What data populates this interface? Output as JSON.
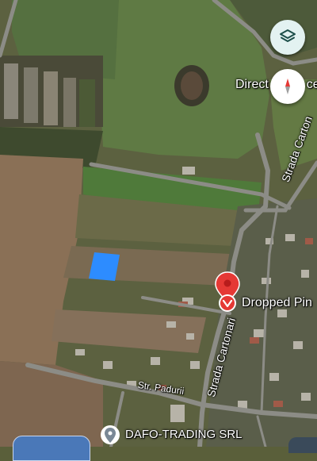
{
  "map": {
    "streets": [
      {
        "label": "Strada Cartonari"
      },
      {
        "label": "Strada Carton"
      },
      {
        "label": "Str. Padurii"
      }
    ],
    "pins": [
      {
        "label": "Dropped Pin",
        "color": "#e53935"
      },
      {
        "label": "DAFO-TRADING SRL"
      }
    ],
    "partial_labels": {
      "direct": "Direct",
      "edge": "ce"
    },
    "colors": {
      "selected_area": "#2d8cff",
      "pin_red": "#e53935"
    }
  },
  "controls": {
    "layers_icon": "layers-icon",
    "compass_icon": "compass-icon"
  }
}
